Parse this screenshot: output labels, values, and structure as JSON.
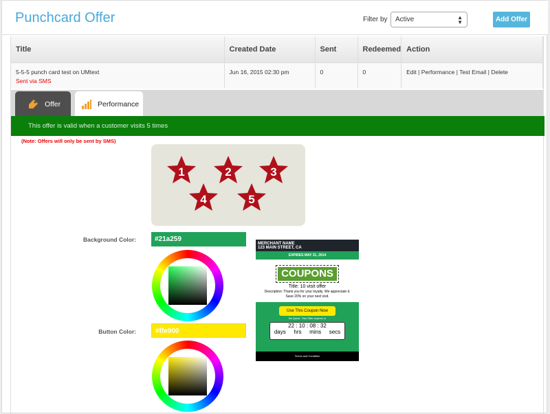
{
  "header": {
    "title": "Punchcard Offer",
    "filter_label": "Filter by",
    "filter_value": "Active",
    "add_button": "Add Offer"
  },
  "table": {
    "columns": [
      "Title",
      "Created Date",
      "Sent",
      "Redeemed",
      "Action"
    ],
    "rows": [
      {
        "title": "5-5-5 punch card test on UMtext",
        "subtitle": "Sent via SMS",
        "created": "Jun 16, 2015 02:30 pm",
        "sent": "0",
        "redeemed": "0",
        "actions": [
          "Edit",
          "Performance",
          "Test Email",
          "Delete"
        ]
      }
    ]
  },
  "tabs": [
    {
      "label": "Offer",
      "icon": "tag-icon"
    },
    {
      "label": "Performance",
      "icon": "bar-chart-icon"
    }
  ],
  "offer": {
    "valid_text": "This offer is valid when a customer visits 5 times",
    "note": "(Note: Offers will only be sent by SMS)",
    "stars": [
      "1",
      "2",
      "3",
      "4",
      "5"
    ],
    "bg_label": "Background Color:",
    "bg_color": "#21a259",
    "btn_label": "Button Color:",
    "btn_color": "#ffe900"
  },
  "coupon": {
    "merchant": "MERCHANT NAME",
    "address": "123 MAIN STREET, CA",
    "expires": "EXPIRES MAY 31, 2014",
    "banner": "COUPONS",
    "title": "Title: 10 visit offer",
    "description": "Description: Thank you for your loyalty. We appreciate it. Save 20% on your next visit.",
    "button": "Use This Coupon Now",
    "hurry": "Be Quick. This Offer expires in",
    "countdown": [
      "22",
      "10",
      "08",
      "32"
    ],
    "units": [
      "days",
      "hrs",
      "mins",
      "secs"
    ],
    "footer": "Terms and Condition"
  }
}
